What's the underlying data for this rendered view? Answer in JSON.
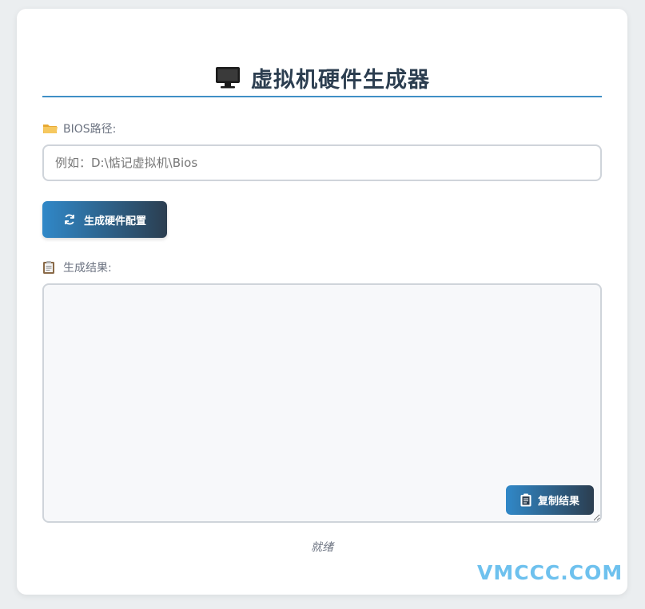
{
  "header": {
    "title": "虚拟机硬件生成器",
    "icon": "monitor-icon"
  },
  "bios": {
    "label": "BIOS路径:",
    "icon": "folder-icon",
    "placeholder": "例如：D:\\惦记虚拟机\\Bios",
    "value": ""
  },
  "actions": {
    "generate_label": "生成硬件配置",
    "generate_icon": "refresh-icon"
  },
  "result": {
    "label": "生成结果:",
    "icon": "clipboard-icon",
    "value": "",
    "copy_label": "复制结果",
    "copy_icon": "clipboard-icon"
  },
  "status": {
    "text": "就绪"
  },
  "watermark": {
    "text": "VMCCC.COM"
  },
  "colors": {
    "accent": "#3088c8",
    "accent_dark": "#2c3e50",
    "watermark": "#6ec1ee",
    "background": "#ebeef0"
  }
}
